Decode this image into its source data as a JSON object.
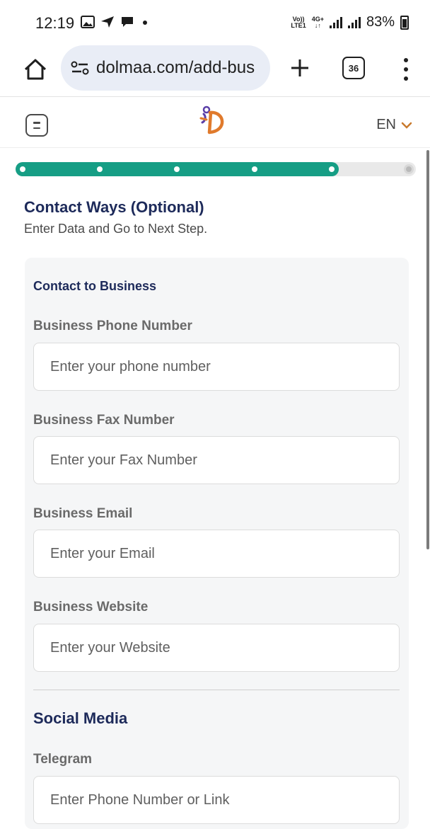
{
  "status_bar": {
    "time": "12:19",
    "net_tag_top": "Vo))",
    "net_tag_bottom": "LTE1",
    "net_type_top": "4G+",
    "net_type_bottom": "↓↑",
    "battery": "83%"
  },
  "browser": {
    "url": "dolmaa.com/add-bus",
    "tab_count": "36"
  },
  "header": {
    "language": "EN"
  },
  "progress": {
    "total_steps": 6,
    "completed_steps": 5
  },
  "page": {
    "title": "Contact Ways (Optional)",
    "subtitle": "Enter Data and Go to Next Step."
  },
  "contact": {
    "heading": "Contact to Business",
    "fields": [
      {
        "label": "Business Phone Number",
        "placeholder": "Enter your phone number"
      },
      {
        "label": "Business Fax Number",
        "placeholder": "Enter your Fax Number"
      },
      {
        "label": "Business Email",
        "placeholder": "Enter your Email"
      },
      {
        "label": "Business Website",
        "placeholder": "Enter your Website"
      }
    ]
  },
  "social": {
    "heading": "Social Media",
    "fields": [
      {
        "label": "Telegram",
        "placeholder": "Enter Phone Number or Link"
      }
    ]
  },
  "colors": {
    "accent": "#169e85",
    "heading": "#1d2a5a",
    "logo_orange": "#e07a2c",
    "logo_purple": "#5b3fa8"
  }
}
